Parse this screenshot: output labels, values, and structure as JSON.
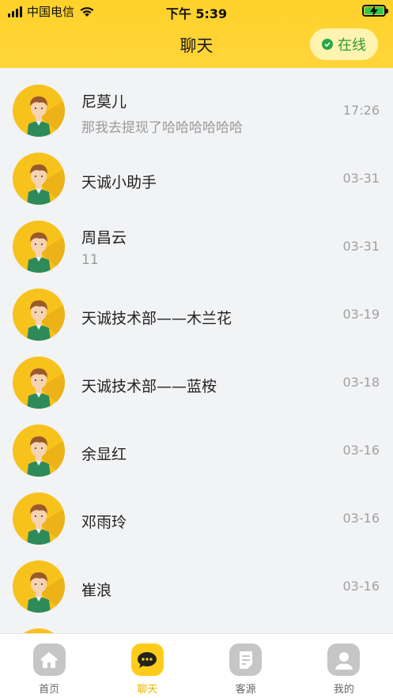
{
  "status": {
    "carrier": "中国电信",
    "time": "下午 5:39"
  },
  "header": {
    "title": "聊天",
    "online_label": "在线"
  },
  "chats": [
    {
      "name": "尼莫儿",
      "preview": "那我去提现了哈哈哈哈哈哈",
      "time": "17:26"
    },
    {
      "name": "天诚小助手",
      "preview": "",
      "time": "03-31"
    },
    {
      "name": "周昌云",
      "preview": "11",
      "time": "03-31"
    },
    {
      "name": "天诚技术部——木兰花",
      "preview": "",
      "time": "03-19"
    },
    {
      "name": "天诚技术部——蓝桉",
      "preview": "",
      "time": "03-18"
    },
    {
      "name": "余显红",
      "preview": "",
      "time": "03-16"
    },
    {
      "name": "邓雨玲",
      "preview": "",
      "time": "03-16"
    },
    {
      "name": "崔浪",
      "preview": "",
      "time": "03-16"
    }
  ],
  "tabs": [
    {
      "label": "首页",
      "icon": "home-icon"
    },
    {
      "label": "聊天",
      "icon": "chat-icon"
    },
    {
      "label": "客源",
      "icon": "document-icon"
    },
    {
      "label": "我的",
      "icon": "user-icon"
    }
  ],
  "colors": {
    "accent": "#ffd22a",
    "online": "#28a745",
    "tab_active": "#e8b400"
  }
}
